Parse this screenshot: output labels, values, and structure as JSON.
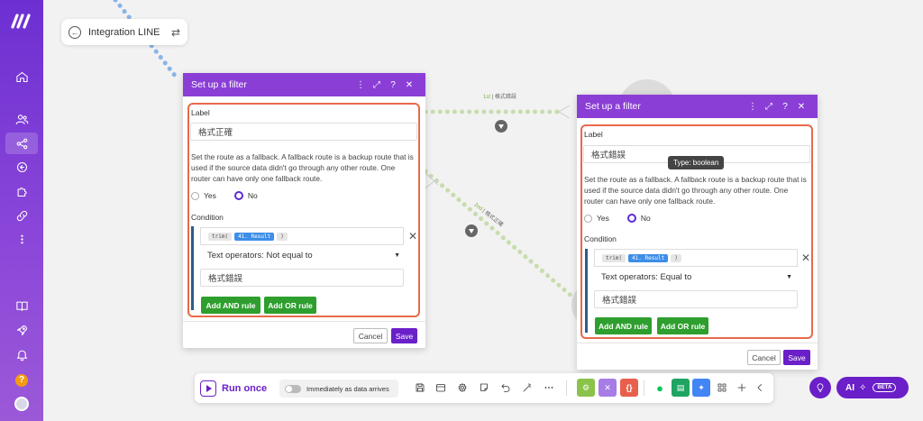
{
  "scenario": {
    "title": "Integration LINE"
  },
  "routes": {
    "first": {
      "ordinal": "1st",
      "label": "格式錯誤"
    },
    "second": {
      "ordinal": "2nd",
      "label": "格式正確"
    }
  },
  "left_filter": {
    "title": "Set up a filter",
    "label_heading": "Label",
    "label_value": "格式正確",
    "fallback_text": "Set the route as a fallback. A fallback route is a backup route that is used if the source data didn't go through any other route. One router can have only one fallback route.",
    "yes_label": "Yes",
    "no_label": "No",
    "condition_heading": "Condition",
    "token_fn": "trim(",
    "token_var": "41. Result",
    "token_close": ")",
    "operator": "Text operators: Not equal to",
    "compare_value": "格式錯誤",
    "add_and": "Add AND rule",
    "add_or": "Add OR rule",
    "cancel": "Cancel",
    "save": "Save"
  },
  "right_filter": {
    "title": "Set up a filter",
    "label_heading": "Label",
    "label_value": "格式錯誤",
    "tooltip": "Type: boolean",
    "fallback_text": "Set the route as a fallback. A fallback route is a backup route that is used if the source data didn't go through any other route. One router can have only one fallback route.",
    "yes_label": "Yes",
    "no_label": "No",
    "condition_heading": "Condition",
    "token_fn": "trim(",
    "token_var": "41. Result",
    "token_close": ")",
    "operator": "Text operators: Equal to",
    "compare_value": "格式錯誤",
    "add_and": "Add AND rule",
    "add_or": "Add OR rule",
    "cancel": "Cancel",
    "save": "Save"
  },
  "toolbar": {
    "run_label": "Run once",
    "toggle_label": "Immediately as data arrives"
  },
  "ai": {
    "label": "AI",
    "beta": "BETA"
  },
  "colors": {
    "accent": "#6a1fc9",
    "header": "#8b3ed6",
    "green": "#2e9f2e",
    "highlight": "#e8694a"
  }
}
